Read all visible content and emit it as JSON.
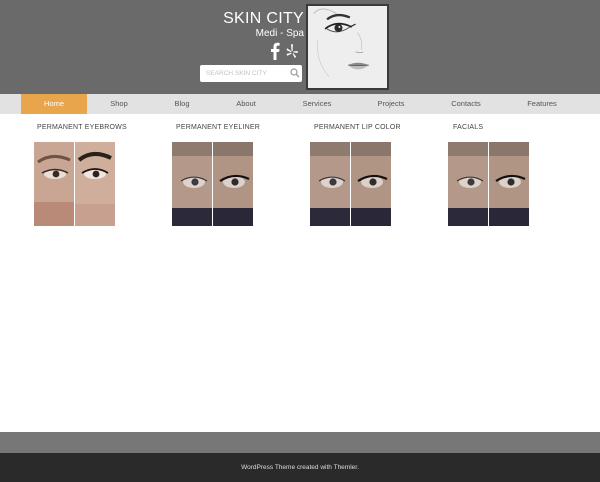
{
  "header": {
    "title": "SKIN CITY",
    "subtitle": "Medi - Spa",
    "social": [
      {
        "icon": "facebook-icon"
      },
      {
        "icon": "yelp-icon"
      }
    ],
    "search": {
      "placeholder": "SEARCH SKIN CITY",
      "icon": "search-icon"
    },
    "logo_image": "face-sketch",
    "bg_color": "#6a6a6a"
  },
  "nav": {
    "items": [
      {
        "label": "Home",
        "active": true
      },
      {
        "label": "Shop"
      },
      {
        "label": "Blog"
      },
      {
        "label": "About"
      },
      {
        "label": "Services"
      },
      {
        "label": "Projects"
      },
      {
        "label": "Contacts"
      },
      {
        "label": "Features"
      }
    ],
    "active_color": "#e8a54c",
    "bg_color": "#e2e2e2"
  },
  "services": [
    {
      "label": "PERMANENT EYEBROWS"
    },
    {
      "label": "PERMANENT EYELINER"
    },
    {
      "label": "PERMANENT LIP COLOR"
    },
    {
      "label": "FACIALS"
    }
  ],
  "footer": {
    "credit": "WordPress Theme created with Themler.",
    "bg_color": "#2a2a2a"
  }
}
